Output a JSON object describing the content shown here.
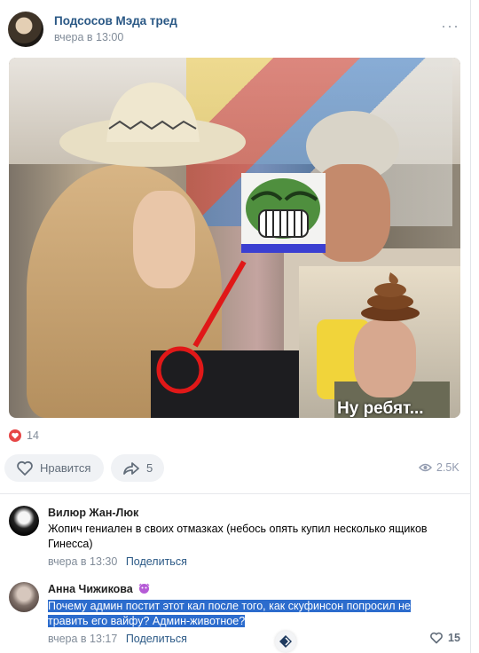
{
  "post": {
    "group_name": "Подсосов Мэда тред",
    "time": "вчера в 13:00",
    "more_icon": "more-dots-icon",
    "image": {
      "caption": "Ну ребят..."
    },
    "reactions_count": "14",
    "like_label": "Нравится",
    "share_count": "5",
    "views": "2.5K"
  },
  "comments": [
    {
      "author": "Вилюр Жан-Люк",
      "text": "Жопич гениален в своих отмазках (небось опять купил несколько ящиков Гинесса)",
      "time": "вчера в 13:30",
      "share_label": "Поделиться"
    },
    {
      "author": "Анна Чижикова",
      "text_line1": "Почему админ постит этот кал после того, как скуфинсон попросил не",
      "text_line2": "травить его вайфу? Админ-животное?",
      "time": "вчера в 13:17",
      "share_label": "Поделиться",
      "likes": "15"
    }
  ],
  "colors": {
    "link": "#2a5885",
    "meta": "#818c99",
    "selection": "#2c6ccd",
    "like_red": "#e64646"
  }
}
